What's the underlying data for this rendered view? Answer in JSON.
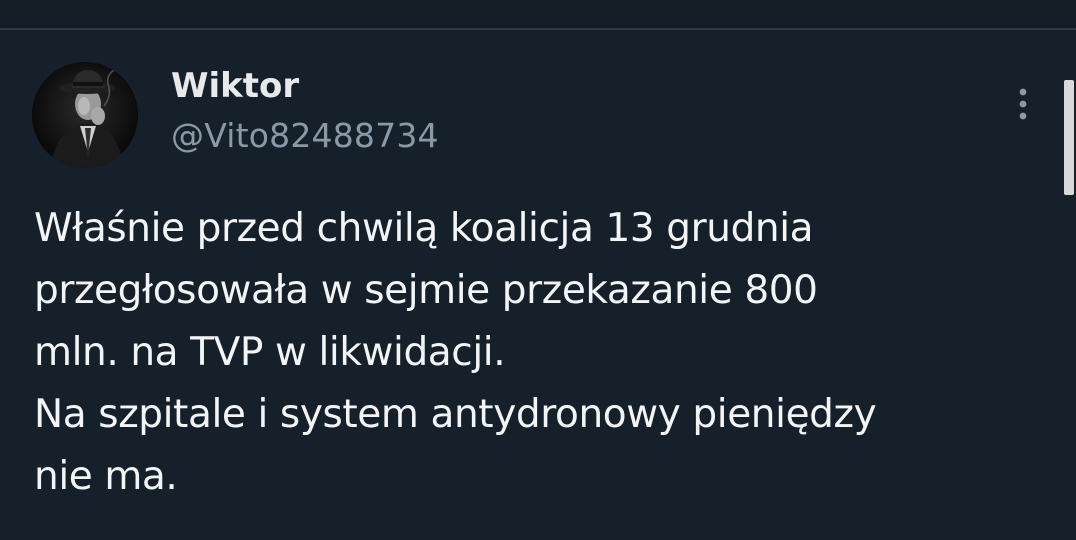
{
  "tweet": {
    "author": {
      "display_name": "Wiktor",
      "handle": "@Vito82488734",
      "avatar_icon": "avatar-photo-man-in-hat"
    },
    "more_icon": "more-vertical-icon",
    "text_lines": [
      "Właśnie przed chwilą koalicja 13 grudnia",
      "przegłosowała w sejmie przekazanie 800",
      "mln. na TVP w likwidacji.",
      "Na szpitale i system antydronowy pieniędzy",
      "nie ma."
    ]
  },
  "colors": {
    "background": "#15202b",
    "text": "#e7e9ea",
    "secondary_text": "#8b98a5"
  }
}
